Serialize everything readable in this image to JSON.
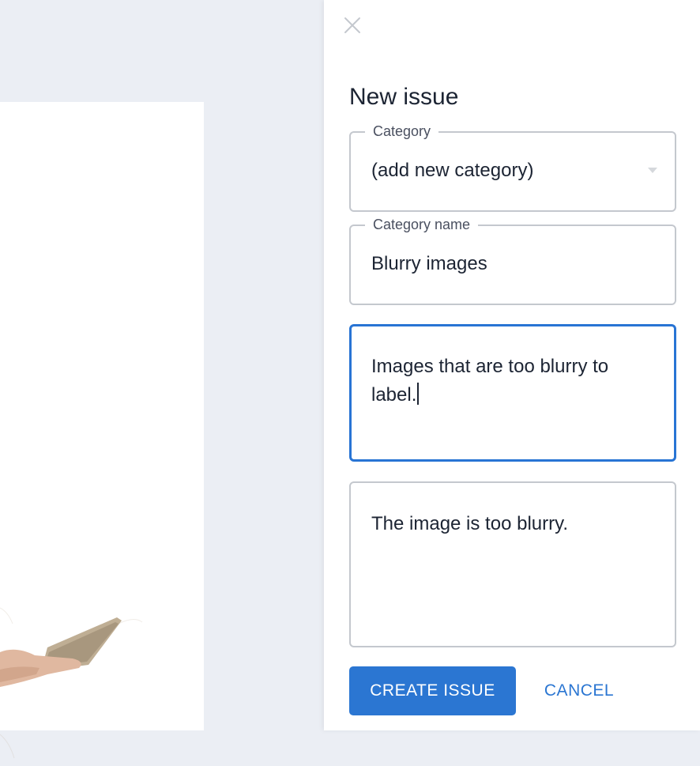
{
  "panel": {
    "title": "New issue",
    "close_icon": "close-icon"
  },
  "category": {
    "label": "Category",
    "value": "(add new category)",
    "icon": "chevron-down-icon"
  },
  "category_name": {
    "label": "Category name",
    "value": "Blurry images"
  },
  "description": {
    "value": "Images that are too blurry to label."
  },
  "message": {
    "value": "The image is too blurry."
  },
  "actions": {
    "create_label": "CREATE ISSUE",
    "cancel_label": "CANCEL"
  },
  "colors": {
    "accent": "#2b76d2",
    "background": "#ebeef4",
    "text": "#1c2433"
  }
}
